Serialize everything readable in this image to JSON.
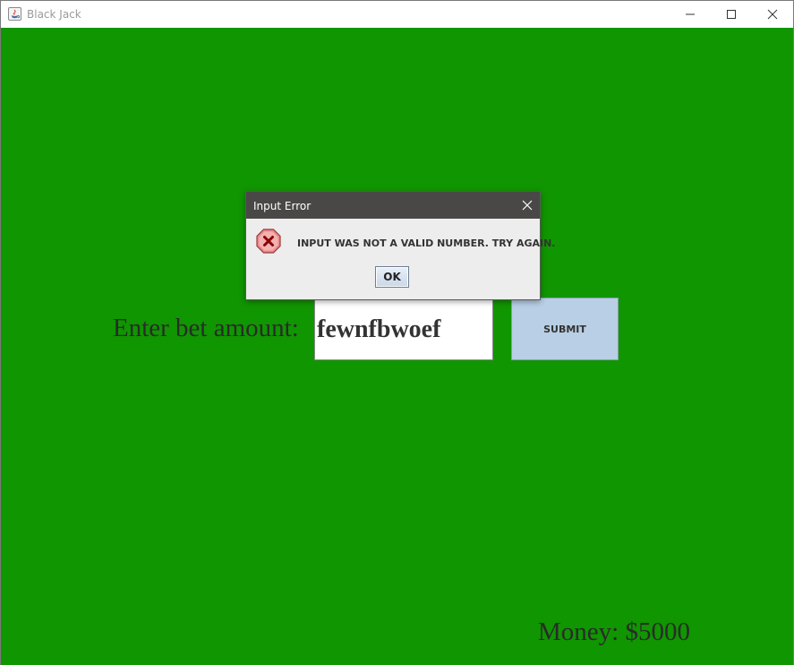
{
  "window": {
    "title": "Black Jack",
    "background_color": "#109600"
  },
  "bet": {
    "label": "Enter bet amount:",
    "input_value": "fewnfbwoef",
    "submit_label": "SUBMIT"
  },
  "money": {
    "label": "Money: $5000"
  },
  "dialog": {
    "title": "Input Error",
    "message": "INPUT WAS NOT A VALID NUMBER. TRY AGAIN.",
    "ok_label": "OK",
    "icon": "error-stop-icon"
  }
}
